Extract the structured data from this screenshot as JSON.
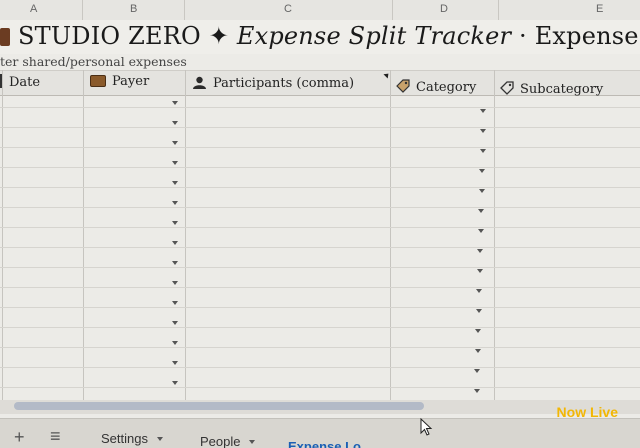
{
  "columns": [
    "A",
    "B",
    "C",
    "D",
    "E"
  ],
  "title": {
    "brand": "STUDIO ZERO",
    "separator": "✦",
    "app_name": "Expense Split Tracker",
    "dot": "·",
    "sheet_name": "Expense Log"
  },
  "subtitle": "ter shared/personal expenses",
  "headers": {
    "date": "Date",
    "payer": "Payer",
    "participants": "Participants (comma)",
    "category": "Category",
    "subcategory": "Subcategory"
  },
  "tabs": {
    "settings": "Settings",
    "people": "People",
    "expense_log": "Expense Lo"
  },
  "overlay": {
    "live_label": "Now Live"
  },
  "icons": {
    "add": "add-sheet-icon",
    "menu": "all-sheets-icon"
  },
  "colors": {
    "active_tab": "#1a5fb4",
    "live": "#f2b705"
  }
}
